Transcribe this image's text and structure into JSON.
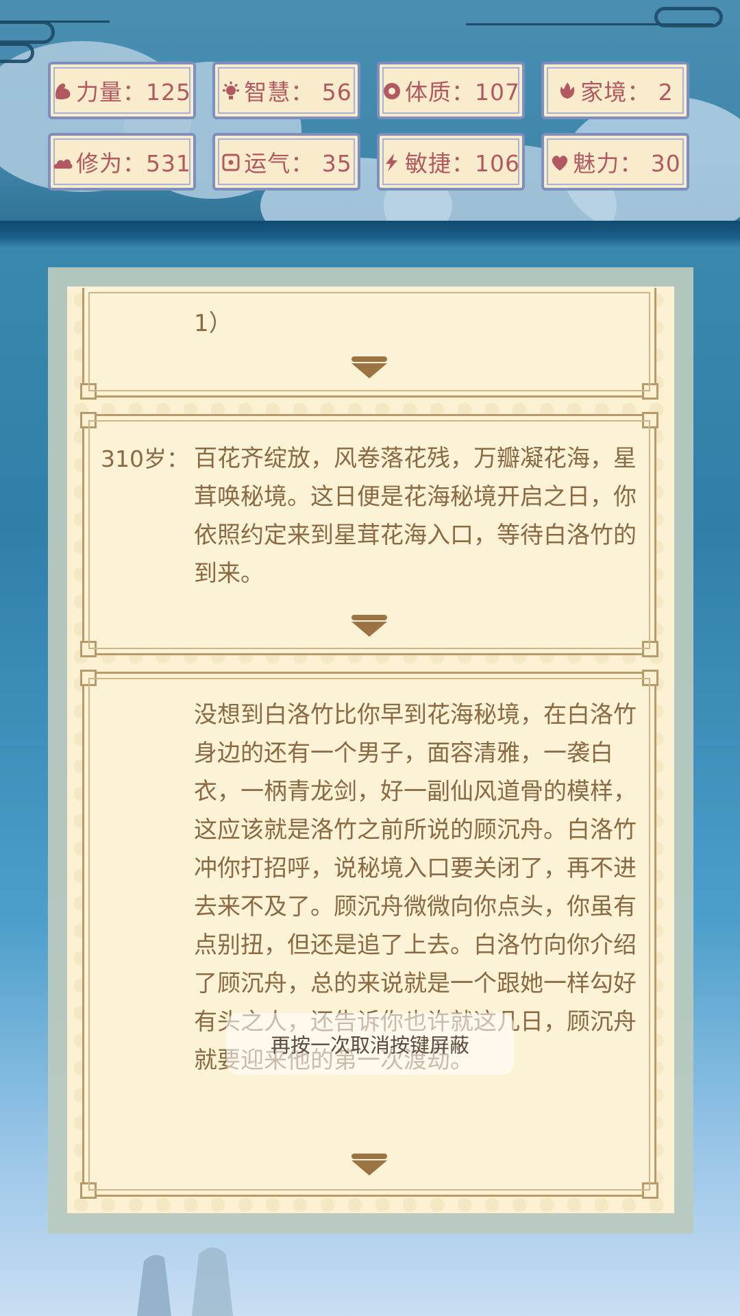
{
  "stats": [
    {
      "icon": "strength-icon",
      "label": "力量：125"
    },
    {
      "icon": "wisdom-icon",
      "label": "智慧：  56"
    },
    {
      "icon": "constitution-icon",
      "label": "体质：107"
    },
    {
      "icon": "family-icon",
      "label": "家境：  2"
    },
    {
      "icon": "cultivation-icon",
      "label": "修为：531"
    },
    {
      "icon": "luck-icon",
      "label": "运气：  35"
    },
    {
      "icon": "agility-icon",
      "label": "敏捷：106"
    },
    {
      "icon": "charm-icon",
      "label": "魅力：  30"
    }
  ],
  "events": [
    {
      "age": "",
      "text": "1）"
    },
    {
      "age": "310岁：",
      "text": "百花齐绽放，风卷落花残，万瓣凝花海，星茸唤秘境。这日便是花海秘境开启之日，你依照约定来到星茸花海入口，等待白洛竹的到来。"
    },
    {
      "age": "",
      "text": "没想到白洛竹比你早到花海秘境，在白洛竹身边的还有一个男子，面容清雅，一袭白衣，一柄青龙剑，好一副仙风道骨的模样，这应该就是洛竹之前所说的顾沉舟。白洛竹冲你打招呼，说秘境入口要关闭了，再不进去来不及了。顾沉舟微微向你点头，你虽有点别扭，但还是追了上去。白洛竹向你介绍了顾沉舟，总的来说就是一个跟她一样勾好有头之人，还告诉你也许就这几日，顾沉舟就要迎来他的第一次渡劫。"
    }
  ],
  "toast": "再按一次取消按键屏蔽",
  "colors": {
    "stat_text": "#b25860",
    "body_text": "#8a6a43",
    "card_border": "#b89a6a"
  }
}
